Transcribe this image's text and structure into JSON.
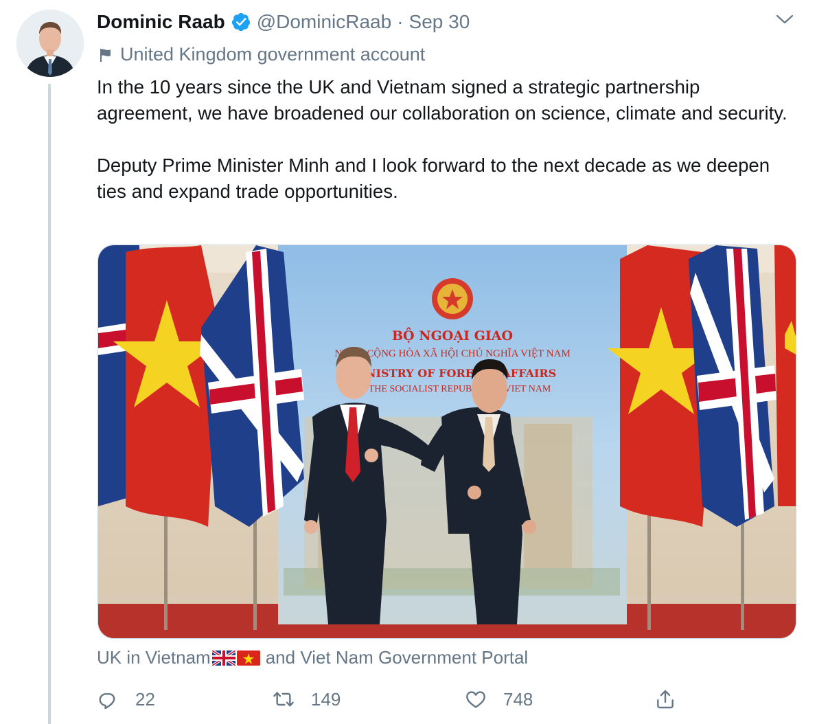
{
  "tweet": {
    "author_name": "Dominic Raab",
    "handle": "@DominicRaab",
    "separator": "·",
    "date": "Sep 30",
    "label": "United Kingdom government account",
    "paragraphs": [
      "In the 10 years since the UK and Vietnam signed a strategic partnership agreement, we have broadened our collaboration on science, climate and security.",
      "Deputy Prime Minister Minh and I look forward to the next decade as we deepen ties and expand trade opportunities."
    ]
  },
  "media": {
    "banner_line1": "BỘ NGOẠI GIAO",
    "banner_line2": "NƯỚC CỘNG HÒA XÃ HỘI CHỦ NGHĨA VIỆT NAM",
    "banner_line3": "MINISTRY OF FOREIGN AFFAIRS",
    "banner_line4": "OF THE SOCIALIST REPUBLIC OF VIET NAM"
  },
  "tagged": {
    "first": "UK in Vietnam",
    "and": "and Viet Nam Government Portal"
  },
  "actions": {
    "replies": "22",
    "retweets": "149",
    "likes": "748"
  },
  "colors": {
    "verified": "#1da1f2",
    "secondary_text": "#657786",
    "border": "#ccd6dd"
  },
  "icons": [
    "verified-badge-icon",
    "chevron-down-icon",
    "flag-icon",
    "reply-icon",
    "retweet-icon",
    "like-icon",
    "share-icon"
  ]
}
